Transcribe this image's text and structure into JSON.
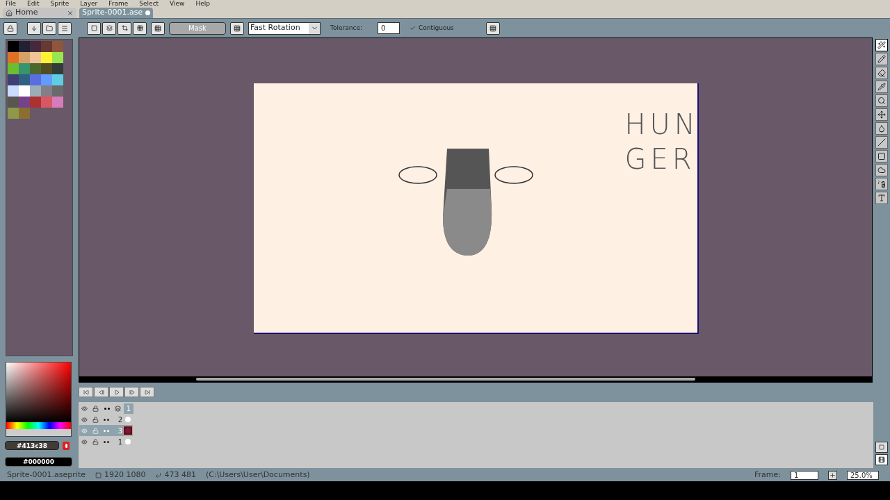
{
  "menu": [
    "File",
    "Edit",
    "Sprite",
    "Layer",
    "Frame",
    "Select",
    "View",
    "Help"
  ],
  "tabs": [
    {
      "label": "Home",
      "kind": "home",
      "selected": false,
      "modified": false
    },
    {
      "label": "Sprite-0001.ase",
      "kind": "document",
      "selected": true,
      "modified": true
    }
  ],
  "toolbar": {
    "mask_label": "Mask",
    "rotation": "Fast Rotation",
    "tolerance_label": "Tolerance:",
    "tolerance": "0",
    "contiguous": {
      "label": "Contiguous",
      "checked": true
    }
  },
  "palette": [
    {
      "color": "#000000"
    },
    {
      "color": "#222034"
    },
    {
      "color": "#45283c"
    },
    {
      "color": "#663931"
    },
    {
      "color": "#8f563b"
    },
    {
      "color": "#df7126"
    },
    {
      "color": "#d9a066"
    },
    {
      "color": "#eec39a"
    },
    {
      "color": "#fbf236"
    },
    {
      "color": "#99e550"
    },
    {
      "color": "#6abe30"
    },
    {
      "color": "#37946e"
    },
    {
      "color": "#4b692f"
    },
    {
      "color": "#524b24"
    },
    {
      "color": "#323c39"
    },
    {
      "color": "#3f3f74"
    },
    {
      "color": "#306082"
    },
    {
      "color": "#5b6ee1"
    },
    {
      "color": "#639bff"
    },
    {
      "color": "#5fcde4"
    },
    {
      "color": "#cbdbfc"
    },
    {
      "color": "#ffffff"
    },
    {
      "color": "#9badb7"
    },
    {
      "color": "#847e87"
    },
    {
      "color": "#696a6a"
    },
    {
      "color": "#595652"
    },
    {
      "color": "#76428a"
    },
    {
      "color": "#ac3232"
    },
    {
      "color": "#d95763"
    },
    {
      "color": "#d77bba"
    },
    {
      "color": "#8f974a"
    },
    {
      "color": "#8a6f30"
    }
  ],
  "foreground": "#413c38",
  "background": "#000000",
  "canvas": {
    "text_lines": [
      "HUN",
      "GER"
    ]
  },
  "tools": [
    {
      "kind": "wand",
      "selected": true
    },
    {
      "kind": "pencil",
      "selected": false
    },
    {
      "kind": "eraser",
      "selected": false
    },
    {
      "kind": "eyedropper",
      "selected": false
    },
    {
      "kind": "zoom",
      "selected": false
    },
    {
      "kind": "move",
      "selected": false
    },
    {
      "kind": "bucket",
      "selected": false
    },
    {
      "kind": "line",
      "selected": false
    },
    {
      "kind": "rectangle",
      "selected": false
    },
    {
      "kind": "blob",
      "selected": false
    },
    {
      "kind": "spray",
      "selected": false
    },
    {
      "kind": "text",
      "selected": false
    }
  ],
  "timeline": {
    "frame_header": "1",
    "layers": [
      {
        "name": "2",
        "selected": false
      },
      {
        "name": "3",
        "selected": true
      },
      {
        "name": "1",
        "selected": false
      }
    ]
  },
  "status": {
    "file": "Sprite-0001.aseprite",
    "size": "1920 1080",
    "position": "473 481",
    "path": "(C:\\Users\\User\\Documents)",
    "frame_label": "Frame:",
    "frame": "1",
    "zoom": "25.0%"
  }
}
